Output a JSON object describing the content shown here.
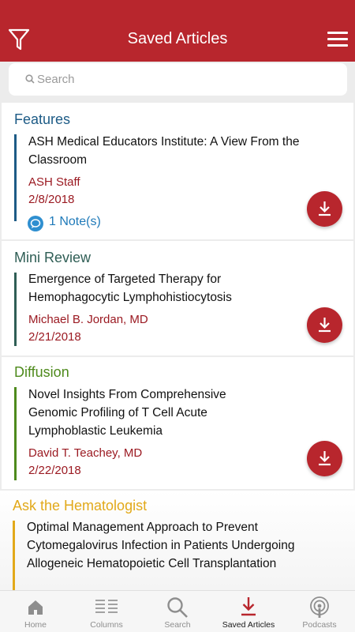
{
  "header": {
    "title": "Saved Articles",
    "filter_icon": "filter-icon",
    "menu_icon": "hamburger-menu-icon"
  },
  "search": {
    "placeholder": "Search"
  },
  "colors": {
    "brand": "#b8262d",
    "features": "#1d5b86",
    "mini_review": "#2f5e55",
    "diffusion": "#4e8a1c",
    "ask_hematologist": "#e2a91a",
    "author": "#9b1a22",
    "note": "#1f7ab9"
  },
  "articles": [
    {
      "section": "Features",
      "title": "ASH Medical Educators Institute: A View From the Classroom",
      "author": "ASH Staff",
      "date": "2/8/2018",
      "note": "1 Note(s)"
    },
    {
      "section": "Mini Review",
      "title": "Emergence of Targeted Therapy for Hemophagocytic Lymphohistiocytosis",
      "author": "Michael B. Jordan, MD",
      "date": "2/21/2018"
    },
    {
      "section": "Diffusion",
      "title": "Novel Insights From Comprehensive Genomic Profiling of T Cell Acute Lymphoblastic Leukemia",
      "author": "David T. Teachey, MD",
      "date": "2/22/2018"
    },
    {
      "section": "Ask the Hematologist",
      "title": "Optimal Management Approach to Prevent Cytomegalovirus Infection in Patients Undergoing Allogeneic Hematopoietic Cell Transplantation"
    }
  ],
  "tabs": [
    {
      "label": "Home",
      "icon": "home-icon"
    },
    {
      "label": "Columns",
      "icon": "columns-icon"
    },
    {
      "label": "Search",
      "icon": "search-icon"
    },
    {
      "label": "Saved Articles",
      "icon": "download-icon",
      "active": true
    },
    {
      "label": "Podcasts",
      "icon": "podcast-icon"
    }
  ]
}
